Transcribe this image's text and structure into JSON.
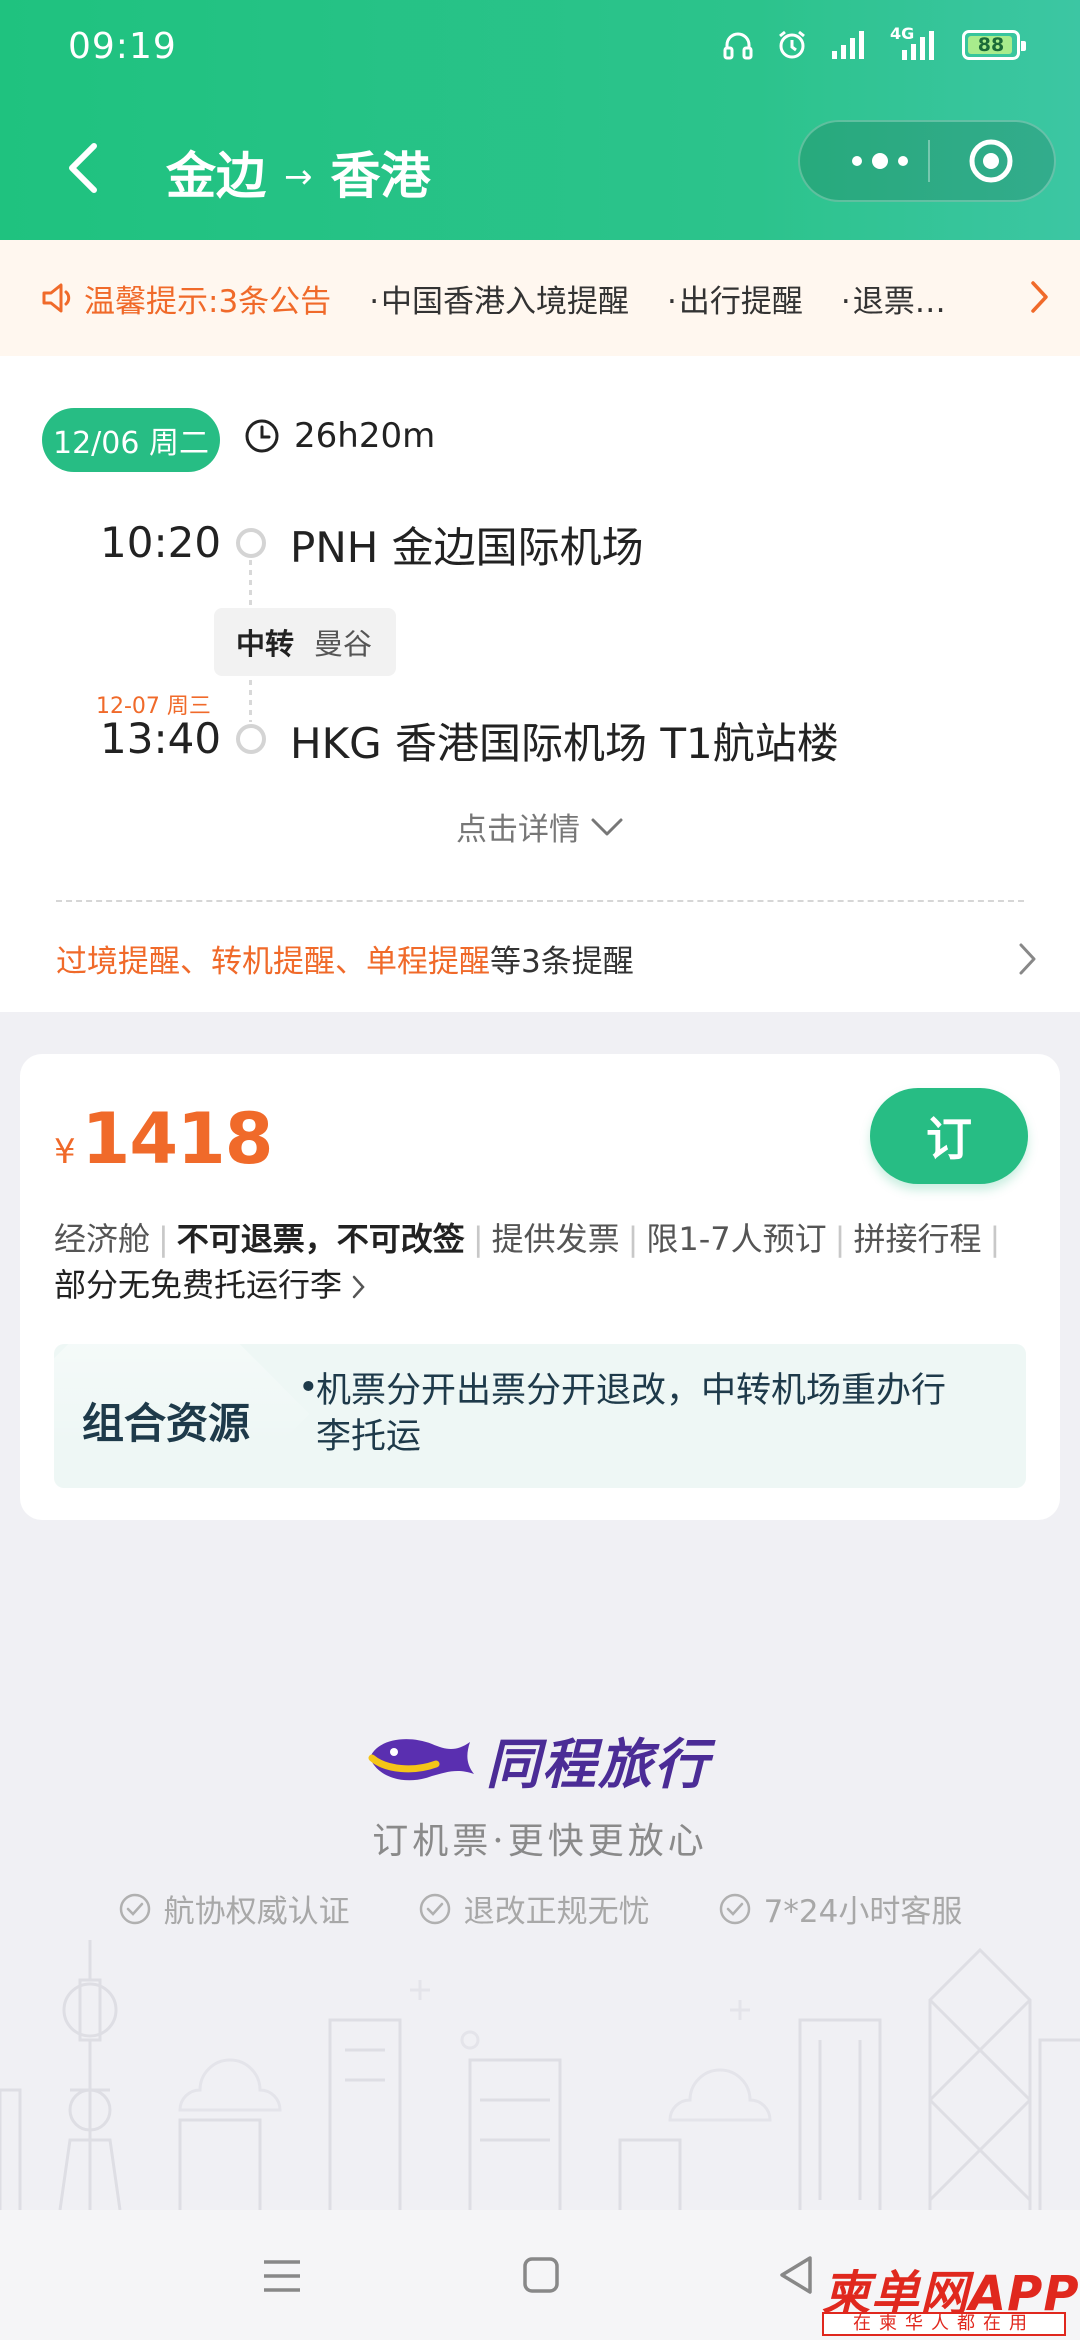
{
  "status_bar": {
    "time": "09:19",
    "network": "4G",
    "battery": "88"
  },
  "nav": {
    "origin": "金边",
    "arrow": "→",
    "destination": "香港"
  },
  "notice": {
    "label": "温馨提示:",
    "count": "3条公告",
    "items": [
      "中国香港入境提醒",
      "出行提醒",
      "退票…"
    ]
  },
  "flight": {
    "date": "12/06 周二",
    "duration": "26h20m",
    "departure_time": "10:20",
    "departure_airport": "PNH 金边国际机场",
    "transit_tag": "中转",
    "transit_city": "曼谷",
    "arrival_date": "12-07 周三",
    "arrival_time": "13:40",
    "arrival_airport": "HKG 香港国际机场 T1航站楼",
    "details_label": "点击详情",
    "reminders_highlight": "过境提醒、转机提醒、单程提醒",
    "reminders_rest": "等3条提醒"
  },
  "fare": {
    "currency": "¥",
    "price": "1418",
    "book_label": "订",
    "features": [
      "经济舱",
      "不可退票，不可改签",
      "提供发票",
      "限1-7人预订",
      "拼接行程"
    ],
    "baggage": "部分无免费托运行李",
    "combo_title": "组合资源",
    "combo_desc": "机票分开出票分开退改，中转机场重办行李托运"
  },
  "brand": {
    "name": "同程旅行",
    "slogan": "订机票·更快更放心",
    "badges": [
      "航协权威认证",
      "退改正规无忧",
      "7*24小时客服"
    ]
  },
  "watermark": {
    "main": "柬单网APP",
    "sub": "在柬华人都在用"
  },
  "colors": {
    "brand_green": "#27bd84",
    "accent_orange": "#f06a2a",
    "brand_purple": "#4b2c96"
  }
}
